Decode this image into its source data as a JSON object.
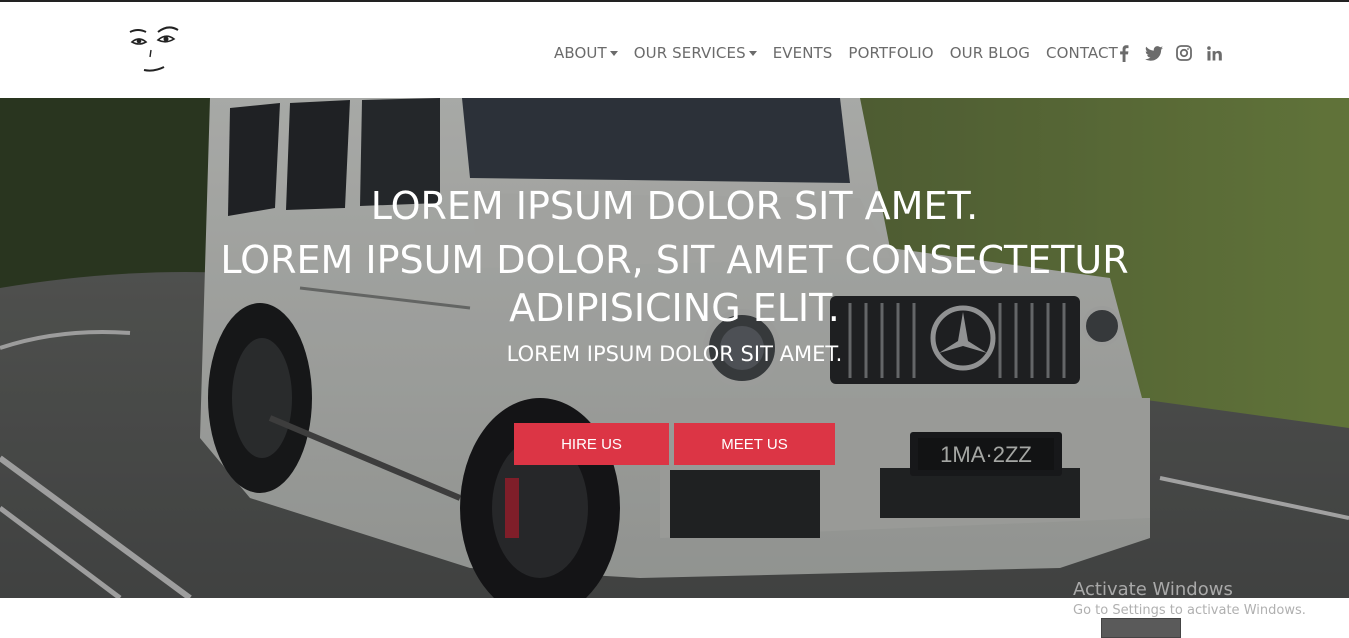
{
  "nav": {
    "items": [
      {
        "label": "ABOUT",
        "dropdown": true
      },
      {
        "label": "OUR SERVICES",
        "dropdown": true
      },
      {
        "label": "EVENTS",
        "dropdown": false
      },
      {
        "label": "PORTFOLIO",
        "dropdown": false
      },
      {
        "label": "OUR BLOG",
        "dropdown": false
      },
      {
        "label": "CONTACT",
        "dropdown": false
      }
    ],
    "social": [
      "facebook-icon",
      "twitter-icon",
      "instagram-icon",
      "linkedin-icon"
    ]
  },
  "hero": {
    "line1": "LOREM IPSUM DOLOR SIT AMET.",
    "line2": "LOREM IPSUM DOLOR, SIT AMET CONSECTETUR ADIPISICING ELIT.",
    "line3": "LOREM IPSUM DOLOR SIT AMET.",
    "btn_hire": "HIRE US",
    "btn_meet": "MEET US",
    "plate": "1MA·2ZZ"
  },
  "watermark": {
    "title": "Activate Windows",
    "subtitle": "Go to Settings to activate Windows."
  },
  "colors": {
    "accent": "#dc3545",
    "nav_text": "#6b6b6b",
    "icon": "#6b6b6b"
  }
}
